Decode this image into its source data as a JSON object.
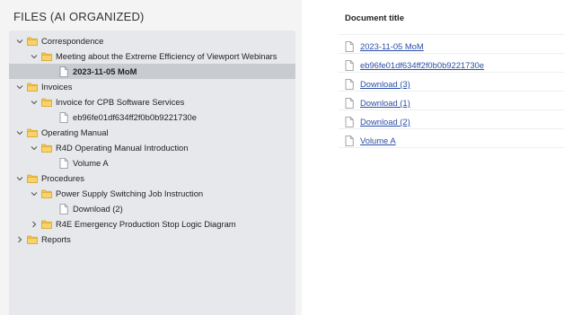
{
  "left_panel": {
    "title": "FILES (AI ORGANIZED)",
    "tree": [
      {
        "label": "Correspondence",
        "level": 0,
        "kind": "folder",
        "expanded": true
      },
      {
        "label": "Meeting about the Extreme Efficiency of Viewport Webinars",
        "level": 1,
        "kind": "folder",
        "expanded": true
      },
      {
        "label": "2023-11-05 MoM",
        "level": 2,
        "kind": "file",
        "selected": true
      },
      {
        "label": "Invoices",
        "level": 0,
        "kind": "folder",
        "expanded": true
      },
      {
        "label": "Invoice for CPB Software Services",
        "level": 1,
        "kind": "folder",
        "expanded": true
      },
      {
        "label": "eb96fe01df634ff2f0b0b9221730e",
        "level": 2,
        "kind": "file"
      },
      {
        "label": "Operating Manual",
        "level": 0,
        "kind": "folder",
        "expanded": true
      },
      {
        "label": "R4D Operating Manual Introduction",
        "level": 1,
        "kind": "folder",
        "expanded": true
      },
      {
        "label": "Volume A",
        "level": 2,
        "kind": "file"
      },
      {
        "label": "Procedures",
        "level": 0,
        "kind": "folder",
        "expanded": true
      },
      {
        "label": "Power Supply Switching Job Instruction",
        "level": 1,
        "kind": "folder",
        "expanded": true
      },
      {
        "label": "Download (2)",
        "level": 2,
        "kind": "file"
      },
      {
        "label": "R4E Emergency Production Stop Logic Diagram",
        "level": 1,
        "kind": "folder",
        "expanded": false
      },
      {
        "label": "Reports",
        "level": 0,
        "kind": "folder",
        "expanded": false
      }
    ]
  },
  "right_panel": {
    "header": "Document title",
    "documents": [
      "2023-11-05 MoM",
      "eb96fe01df634ff2f0b0b9221730e",
      "Download (3)",
      "Download (1)",
      "Download (2)",
      "Volume A"
    ]
  },
  "colors": {
    "tree_background": "#e6e8eb",
    "selected_row": "#c8cbcf",
    "folder_fill": "#f3c44f",
    "link": "#2b4ea8"
  },
  "icons": {
    "expanded": "chevron-down-icon",
    "collapsed": "chevron-right-icon",
    "folder": "folder-icon",
    "file": "document-icon"
  }
}
